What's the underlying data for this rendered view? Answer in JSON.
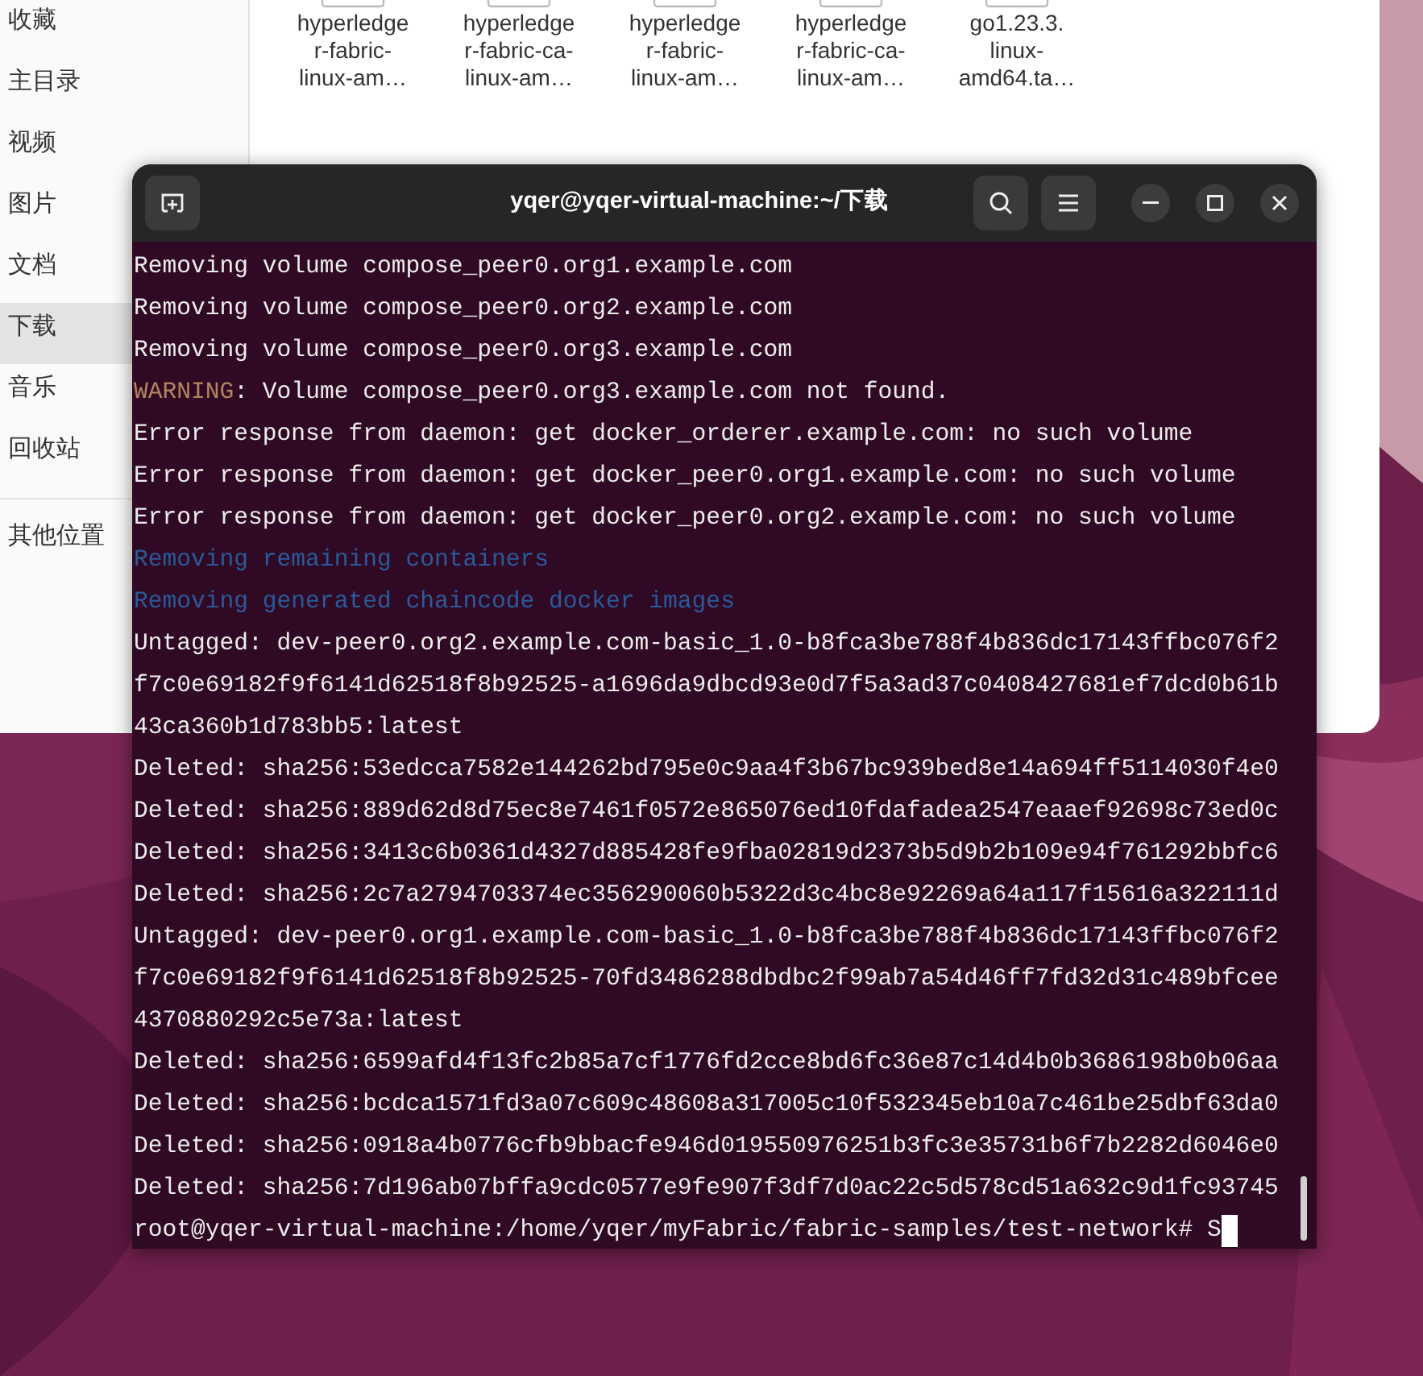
{
  "file_manager": {
    "sidebar": [
      {
        "label": "收藏",
        "selected": false
      },
      {
        "label": "主目录",
        "selected": false
      },
      {
        "label": "视频",
        "selected": false
      },
      {
        "label": "图片",
        "selected": false
      },
      {
        "label": "文档",
        "selected": false
      },
      {
        "label": "下载",
        "selected": true
      },
      {
        "label": "音乐",
        "selected": false
      },
      {
        "label": "回收站",
        "selected": false
      },
      {
        "label": "其他位置",
        "selected": false
      }
    ],
    "files": [
      {
        "name": "hyperledge r-fabric- linux-am…"
      },
      {
        "name": "hyperledge r-fabric-ca- linux-am…"
      },
      {
        "name": "hyperledge r-fabric- linux-am…"
      },
      {
        "name": "hyperledge r-fabric-ca- linux-am…"
      },
      {
        "name": "go1.23.3. linux- amd64.ta…"
      }
    ]
  },
  "terminal": {
    "title": "yqer@yqer-virtual-machine:~/下载",
    "lines": [
      {
        "kind": "plain",
        "text": "Removing volume compose_peer0.org1.example.com"
      },
      {
        "kind": "plain",
        "text": "Removing volume compose_peer0.org2.example.com"
      },
      {
        "kind": "plain",
        "text": "Removing volume compose_peer0.org3.example.com"
      },
      {
        "kind": "warning",
        "label": "WARNING",
        "text": ": Volume compose_peer0.org3.example.com not found."
      },
      {
        "kind": "plain",
        "text": "Error response from daemon: get docker_orderer.example.com: no such volume"
      },
      {
        "kind": "plain",
        "text": "Error response from daemon: get docker_peer0.org1.example.com: no such volume"
      },
      {
        "kind": "plain",
        "text": "Error response from daemon: get docker_peer0.org2.example.com: no such volume"
      },
      {
        "kind": "info",
        "text": "Removing remaining containers"
      },
      {
        "kind": "info",
        "text": "Removing generated chaincode docker images"
      },
      {
        "kind": "plain",
        "text": "Untagged: dev-peer0.org2.example.com-basic_1.0-b8fca3be788f4b836dc17143ffbc076f2"
      },
      {
        "kind": "plain",
        "text": "f7c0e69182f9f6141d62518f8b92525-a1696da9dbcd93e0d7f5a3ad37c0408427681ef7dcd0b61b"
      },
      {
        "kind": "plain",
        "text": "43ca360b1d783bb5:latest"
      },
      {
        "kind": "plain",
        "text": "Deleted: sha256:53edcca7582e144262bd795e0c9aa4f3b67bc939bed8e14a694ff5114030f4e0"
      },
      {
        "kind": "plain",
        "text": "Deleted: sha256:889d62d8d75ec8e7461f0572e865076ed10fdafadea2547eaaef92698c73ed0c"
      },
      {
        "kind": "plain",
        "text": "Deleted: sha256:3413c6b0361d4327d885428fe9fba02819d2373b5d9b2b109e94f761292bbfc6"
      },
      {
        "kind": "plain",
        "text": "Deleted: sha256:2c7a2794703374ec356290060b5322d3c4bc8e92269a64a117f15616a322111d"
      },
      {
        "kind": "plain",
        "text": "Untagged: dev-peer0.org1.example.com-basic_1.0-b8fca3be788f4b836dc17143ffbc076f2"
      },
      {
        "kind": "plain",
        "text": "f7c0e69182f9f6141d62518f8b92525-70fd3486288dbdbc2f99ab7a54d46ff7fd32d31c489bfcee"
      },
      {
        "kind": "plain",
        "text": "4370880292c5e73a:latest"
      },
      {
        "kind": "plain",
        "text": "Deleted: sha256:6599afd4f13fc2b85a7cf1776fd2cce8bd6fc36e87c14d4b0b3686198b0b06aa"
      },
      {
        "kind": "plain",
        "text": "Deleted: sha256:bcdca1571fd3a07c609c48608a317005c10f532345eb10a7c461be25dbf63da0"
      },
      {
        "kind": "plain",
        "text": "Deleted: sha256:0918a4b0776cfb9bbacfe946d019550976251b3fc3e35731b6f7b2282d6046e0"
      },
      {
        "kind": "plain",
        "text": "Deleted: sha256:7d196ab07bffa9cdc0577e9fe907f3df7d0ac22c5d578cd51a632c9d1fc93745"
      }
    ],
    "prompt": "root@yqer-virtual-machine:/home/yqer/myFabric/fabric-samples/test-network#",
    "input": "S"
  }
}
